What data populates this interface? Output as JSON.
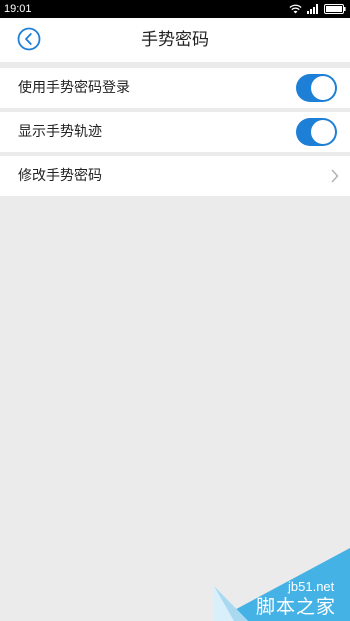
{
  "status_bar": {
    "time": "19:01",
    "icons": [
      "wifi-icon",
      "signal-icon",
      "battery-icon"
    ]
  },
  "header": {
    "title": "手势密码",
    "back_icon": "back-circle-icon"
  },
  "settings": {
    "items": [
      {
        "label": "使用手势密码登录",
        "control": "toggle",
        "on": true
      },
      {
        "label": "显示手势轨迹",
        "control": "toggle",
        "on": true
      },
      {
        "label": "修改手势密码",
        "control": "chevron",
        "icon": "chevron-right-icon"
      }
    ]
  },
  "watermark": {
    "site": "jb51.net",
    "name": "脚本之家"
  },
  "colors": {
    "accent": "#1e7fd6",
    "background": "#ebebeb",
    "status_bar": "#000000",
    "watermark": "#45b2e6"
  }
}
